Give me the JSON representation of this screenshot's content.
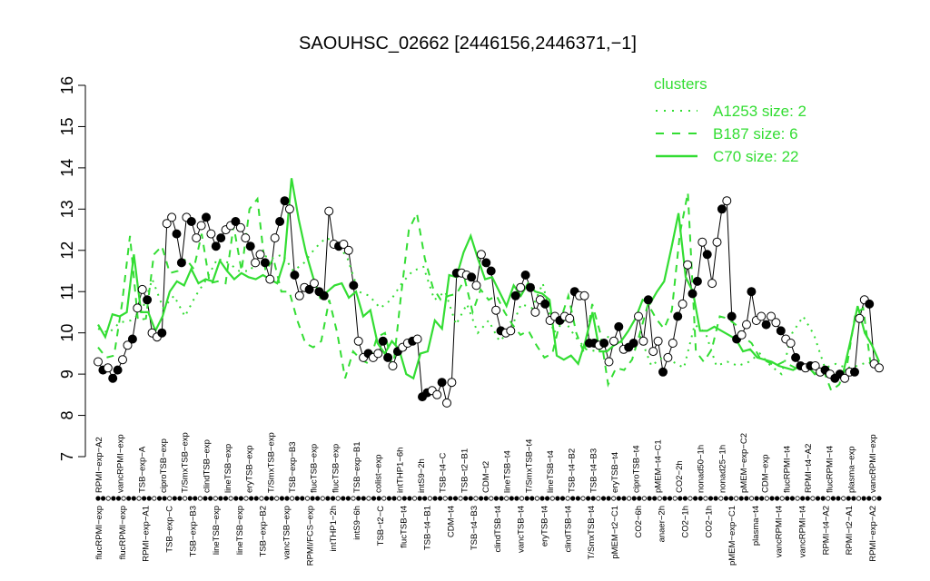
{
  "chart_data": {
    "type": "line",
    "title": "SAOUHSC_02662 [2446156,2446371,−1]",
    "xlabel": "",
    "ylabel": "",
    "ylim": [
      7,
      16
    ],
    "yticks": [
      7,
      8,
      9,
      10,
      11,
      12,
      13,
      14,
      15,
      16
    ],
    "grid": false,
    "legend": {
      "position": "top-right",
      "title": "clusters",
      "color": "#33dd33",
      "entries": [
        {
          "label": "A1253 size: 2",
          "style": "dotted"
        },
        {
          "label": "B187 size: 6",
          "style": "dashed"
        },
        {
          "label": "C70 size: 22",
          "style": "solid"
        }
      ]
    },
    "x_labels_top": [
      "RPMI−exp−A2",
      "vancRPMI−exp",
      "TSB−exp−A",
      "ciproTSB−exp",
      "T/SmxTSB−exp",
      "clindTSB−exp",
      "lineTSB−exp",
      "eryTSB−exp",
      "T/SmxTSB−exp",
      "TSB−exp−B3",
      "flucTSB−exp",
      "flucTSB−exp",
      "TSB−exp−B1",
      "colist−exp",
      "intTHP1−6h",
      "intS9−2h",
      "TSB−t4−C",
      "TSB−t2−B1",
      "CDM−t2",
      "lineTSB−t4",
      "T/SmxTSB−t4",
      "lineTSB−t4",
      "TSB−t4−B2",
      "TSB−t4−B3",
      "eryTSB−t4",
      "ciproTSB−t4",
      "pMEM−t4−C1",
      "CO2−2h",
      "nonad50−1h",
      "nonad25−1h",
      "pMEM−exp−C2",
      "CDM−exp",
      "flucRPMI−t4",
      "RPMI−t4−A2",
      "flucRPMI−t4",
      "plasma−exp",
      "vancRPMI−exp"
    ],
    "x_labels_bottom": [
      "flucRPMI−exp",
      "flucRPMI−exp",
      "RPMI−exp−A1",
      "TSB−exp−C",
      "TSB−exp−B3",
      "lineTSB−exp",
      "lineTSB−exp",
      "TSB−exp−B2",
      "vancTSB−exp",
      "RPMI/FCS−exp",
      "intTHP1−2h",
      "intS9−6h",
      "TSB−t2−C",
      "flucTSB−t4",
      "TSB−t4−B1",
      "CDM−t4",
      "TSB−t4−B3",
      "clindTSB−t4",
      "vancTSB−t4",
      "eryTSB−t4",
      "clindTSB−t4",
      "T/SmxTSB−t4",
      "pMEM−t2−C1",
      "CO2−6h",
      "anaer−2h",
      "CO2−1h",
      "CO2−1h",
      "pMEM−exp−C1",
      "plasma−t4",
      "vancRPMI−t4",
      "vancRPMI−t4",
      "RPMI−t4−A2",
      "RPMI−t2−A1",
      "RPMI−exp−A2"
    ],
    "series": [
      {
        "style": "solid-black-markers",
        "values": [
          9.3,
          9.1,
          9.15,
          8.9,
          9.1,
          9.35,
          9.7,
          9.85,
          10.6,
          11.05,
          10.8,
          10.0,
          9.9,
          10.0,
          12.65,
          12.8,
          12.4,
          11.7,
          12.8,
          12.7,
          12.3,
          12.6,
          12.8,
          12.4,
          12.1,
          12.3,
          12.5,
          12.6,
          12.7,
          12.55,
          12.3,
          12.1,
          11.7,
          11.9,
          11.7,
          11.3,
          12.3,
          12.7,
          13.2,
          13.0,
          11.4,
          10.9,
          11.1,
          11.05,
          11.2,
          11.0,
          10.9,
          12.95,
          12.15,
          12.1,
          12.15,
          12.0,
          11.15,
          9.8,
          9.4,
          9.5,
          9.4,
          9.5,
          9.8,
          9.4,
          9.2,
          9.55,
          9.65,
          9.75,
          9.8,
          9.85,
          8.45,
          8.55,
          8.6,
          8.5,
          8.8,
          8.3,
          8.8,
          11.45,
          11.45,
          11.4,
          11.35,
          11.15,
          11.9,
          11.7,
          11.5,
          10.55,
          10.05,
          10.0,
          10.05,
          10.9,
          11.1,
          11.4,
          11.1,
          10.5,
          10.8,
          10.7,
          10.3,
          10.4,
          10.3,
          10.4,
          10.35,
          11.0,
          10.9,
          10.9,
          9.75,
          9.75,
          9.7,
          9.75,
          9.3,
          9.8,
          10.15,
          9.6,
          9.65,
          9.75,
          10.4,
          9.8,
          10.8,
          9.55,
          9.8,
          9.05,
          9.4,
          9.75,
          10.4,
          10.7,
          11.65,
          10.95,
          11.25,
          12.2,
          11.9,
          11.2,
          12.2,
          13.0,
          13.2,
          10.4,
          9.85,
          9.95,
          10.2,
          11.0,
          10.3,
          10.4,
          10.2,
          10.4,
          10.25,
          10.05,
          9.85,
          9.75,
          9.4,
          9.2,
          9.15,
          9.2,
          9.2,
          9.05,
          9.1,
          9.0,
          8.9,
          9.0,
          8.9,
          9.05,
          9.05,
          10.35,
          10.8,
          10.7,
          9.25,
          9.15
        ]
      },
      {
        "name": "A1253 size: 2",
        "style": "dotted",
        "values": [
          10.1,
          10.0,
          10.25,
          10.3,
          10.5,
          11.3,
          10.6,
          10.9,
          10.4,
          10.9,
          11.3,
          11.8,
          11.7,
          11.5,
          11.5,
          11.9,
          11.8,
          11.9,
          11.5,
          11.7,
          12.05,
          12.3,
          12.2,
          11.8,
          11.0,
          10.9,
          10.6,
          10.8,
          11.2,
          11.5,
          11.6,
          10.8,
          11.0,
          10.2,
          10.7,
          10.0,
          10.3,
          9.8,
          10.05,
          10.7,
          10.6,
          11.2,
          10.0,
          10.3,
          9.9,
          9.6,
          9.55,
          9.9,
          9.8,
          9.7,
          9.9,
          9.2,
          9.4,
          9.3,
          9.15,
          10.2,
          10.0,
          9.2,
          9.3,
          9.2,
          9.3,
          9.5,
          9.2,
          9.0,
          10.0,
          10.4,
          9.95,
          9.15,
          9.25,
          9.15,
          9.2,
          9.3,
          9.1
        ]
      },
      {
        "name": "B187 size: 6",
        "style": "dashed",
        "values": [
          9.65,
          9.4,
          9.45,
          10.7,
          12.35,
          10.3,
          10.35,
          11.9,
          12.1,
          11.45,
          11.5,
          11.8,
          11.55,
          12.4,
          11.2,
          11.25,
          11.2,
          12.6,
          11.5,
          13.0,
          13.25,
          11.5,
          11.8,
          11.0,
          11.0,
          10.3,
          9.75,
          9.65,
          9.8,
          10.8,
          10.0,
          8.9,
          9.55,
          9.35,
          9.25,
          9.9,
          10.0,
          9.1,
          10.9,
          12.5,
          12.9,
          11.8,
          11.1,
          10.8,
          10.9,
          10.95,
          11.3,
          10.5,
          11.05,
          10.8,
          10.9,
          10.5,
          10.2,
          9.95,
          10.05,
          9.7,
          9.4,
          9.5,
          10.3,
          10.9,
          10.0,
          9.5,
          10.7,
          10.0,
          8.75,
          9.15,
          9.1,
          9.35,
          10.0,
          10.7,
          10.35,
          10.1,
          10.55,
          12.4,
          13.4,
          9.55,
          9.3,
          9.6,
          10.4,
          10.35,
          10.2,
          9.9,
          9.75,
          9.4,
          9.3,
          9.2,
          9.3,
          9.2,
          9.1,
          9.2,
          9.0,
          9.1,
          8.6,
          8.75,
          9.25,
          10.45,
          10.6,
          9.15,
          9.3
        ]
      },
      {
        "name": "C70 size: 22",
        "style": "solid",
        "values": [
          10.2,
          9.9,
          10.45,
          10.4,
          10.5,
          11.9,
          10.5,
          10.5,
          10.05,
          10.4,
          11.0,
          11.25,
          11.15,
          11.55,
          11.2,
          11.3,
          11.25,
          11.75,
          11.5,
          11.3,
          11.45,
          11.35,
          11.3,
          11.4,
          11.3,
          11.2,
          11.75,
          13.75,
          12.75,
          11.95,
          11.35,
          10.85,
          11.0,
          11.15,
          11.2,
          10.85,
          11.0,
          10.4,
          10.55,
          9.75,
          9.5,
          9.8,
          9.6,
          9.0,
          8.9,
          9.5,
          9.55,
          10.3,
          10.1,
          11.4,
          11.35,
          11.95,
          12.35,
          11.8,
          11.3,
          11.35,
          11.0,
          10.65,
          11.15,
          10.9,
          11.2,
          11.0,
          10.95,
          10.8,
          9.45,
          9.35,
          9.45,
          9.25,
          9.8,
          10.5,
          9.55,
          9.55,
          9.7,
          9.8,
          10.05,
          10.35,
          10.8,
          10.7,
          11.0,
          11.25,
          12.05,
          12.9,
          11.35,
          11.0,
          10.05,
          10.05,
          10.15,
          10.05,
          9.95,
          9.85,
          9.55,
          9.6,
          9.4,
          9.35,
          9.3,
          9.2,
          9.15,
          9.1,
          9.2,
          9.2,
          9.0,
          9.1,
          9.1,
          8.95,
          9.05,
          9.8,
          10.65,
          10.0,
          9.7,
          9.3
        ]
      }
    ]
  }
}
